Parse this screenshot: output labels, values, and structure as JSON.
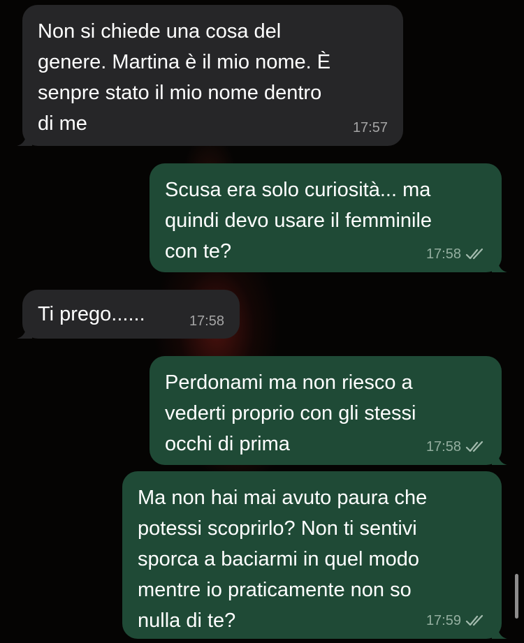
{
  "messages": [
    {
      "direction": "incoming",
      "text": "Non si chiede una cosa del\ngenere. Martina è il mio nome. È\nsenpre stato il mio nome dentro\ndi me",
      "time": "17:57"
    },
    {
      "direction": "outgoing",
      "text": "Scusa era solo curiosità... ma\nquindi devo usare il femminile\ncon te?",
      "time": "17:58",
      "status": "read"
    },
    {
      "direction": "incoming",
      "text": "Ti prego......",
      "time": "17:58"
    },
    {
      "direction": "outgoing",
      "text": "Perdonami ma non riesco a\nvederti proprio con gli stessi\nocchi di prima",
      "time": "17:58",
      "status": "read"
    },
    {
      "direction": "outgoing",
      "text": "Ma non hai mai avuto paura che\npotessi scoprirlo? Non ti sentivi\nsporca a baciarmi in quel modo\nmentre io praticamente non so\nnulla di te?",
      "time": "17:59",
      "status": "read"
    }
  ],
  "colors": {
    "background": "#050403",
    "incoming_bubble": "#262628",
    "outgoing_bubble": "#1f4a36"
  }
}
